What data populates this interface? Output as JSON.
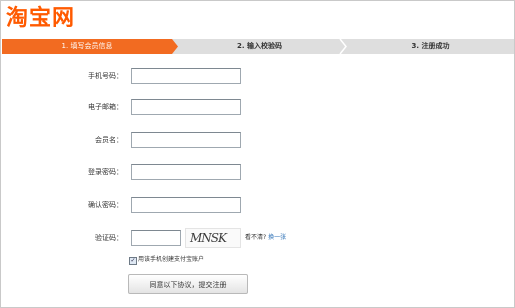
{
  "logo": {
    "text": "淘宝网"
  },
  "steps": [
    {
      "label": "1. 填写会员信息"
    },
    {
      "label": "2. 输入校验码"
    },
    {
      "label": "3. 注册成功"
    }
  ],
  "form": {
    "phone": {
      "label": "手机号码：",
      "value": ""
    },
    "email": {
      "label": "电子邮箱：",
      "value": ""
    },
    "username": {
      "label": "会员名：",
      "value": ""
    },
    "password": {
      "label": "登录密码：",
      "value": ""
    },
    "confirm": {
      "label": "确认密码：",
      "value": ""
    },
    "captcha": {
      "label": "验证码：",
      "value": "",
      "image_text": "MNSK",
      "hint": "看不清?",
      "refresh": "换一张"
    },
    "checkbox": {
      "label": "用该手机创建支付宝账户",
      "checked": true
    },
    "submit": "同意以下协议，提交注册"
  },
  "colors": {
    "brand": "#ff5a00",
    "step_active": "#f26b21",
    "step_inactive": "#dedede"
  }
}
